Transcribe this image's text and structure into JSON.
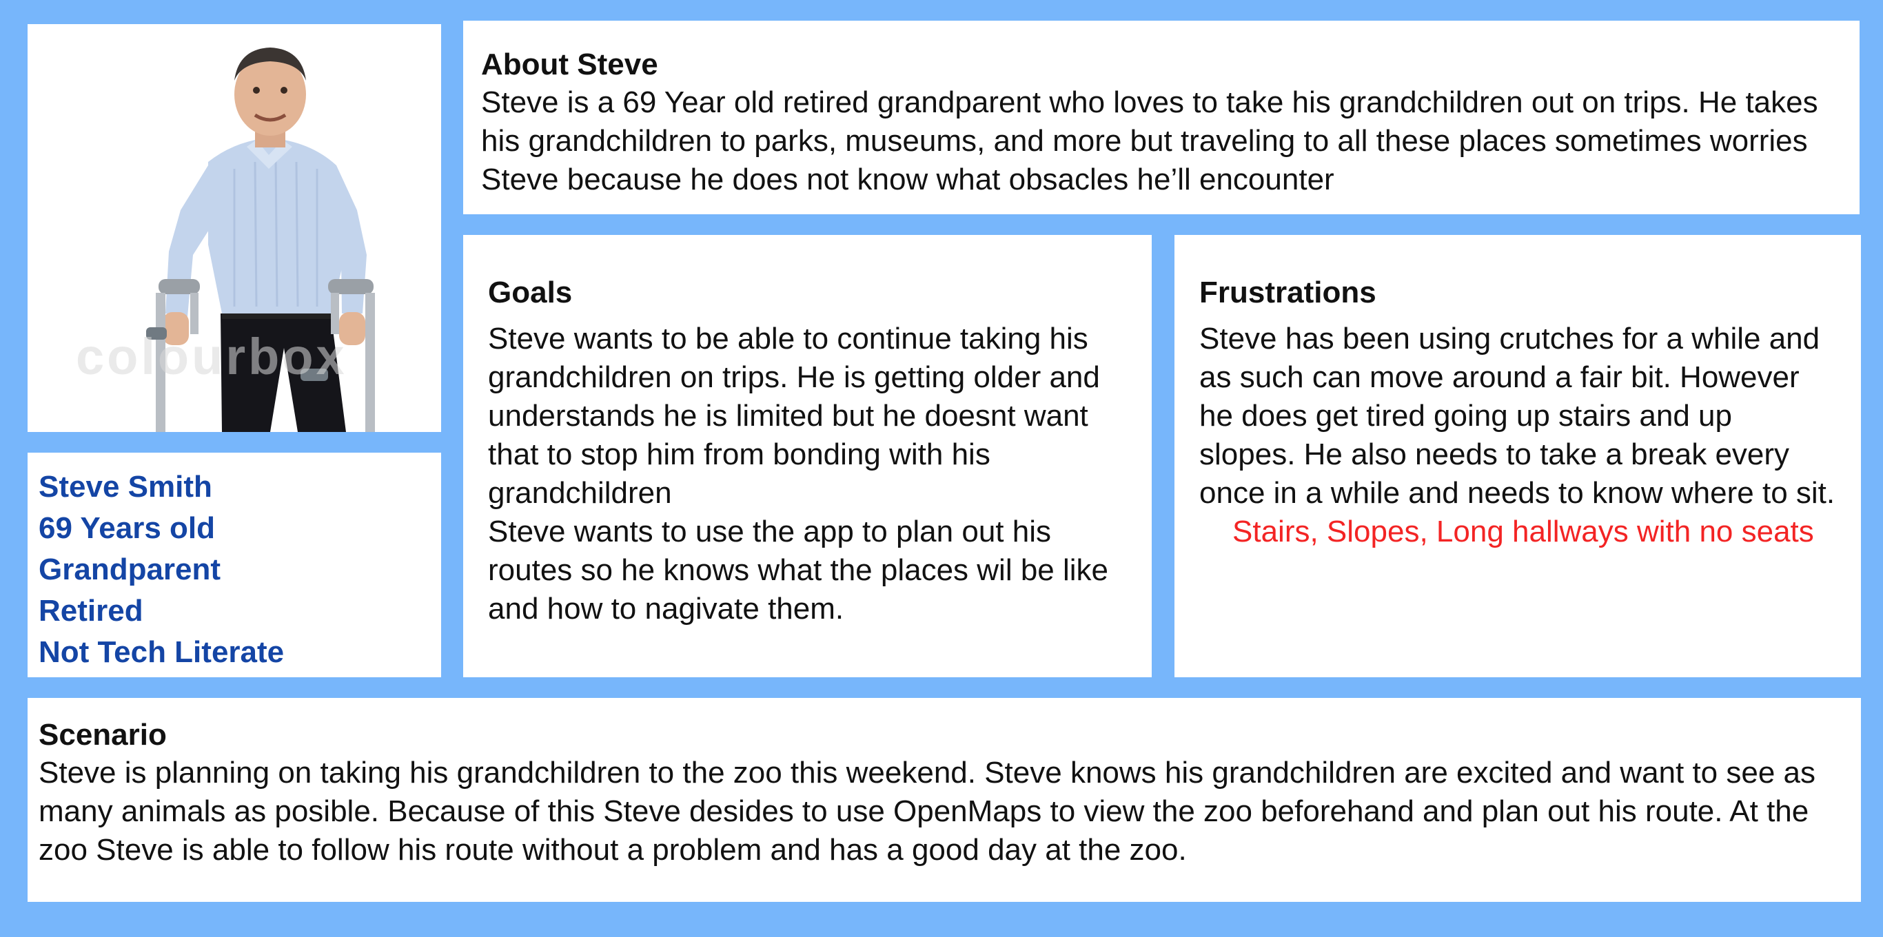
{
  "persona": {
    "name": "Steve Smith",
    "age": "69 Years old",
    "role": "Grandparent",
    "status": "Retired",
    "tech": "Not Tech Literate"
  },
  "photo": {
    "watermark": "colourbox"
  },
  "about": {
    "heading": "About Steve",
    "text": "Steve is a 69 Year old retired grandparent who loves to take his grandchildren out on trips. He takes his grandchildren to parks, museums, and more but traveling to all these places sometimes worries Steve because he does not know what obsacles he’ll encounter"
  },
  "goals": {
    "heading": "Goals",
    "paragraph1": "Steve wants to be able to continue taking his grandchildren on trips. He is getting older and understands he is limited but he doesnt want that to stop him from bonding with his grandchildren",
    "paragraph2": "Steve wants to use the app to plan out his routes so he knows what the places wil be like and how to nagivate them."
  },
  "frustrations": {
    "heading": "Frustrations",
    "text": "Steve has been using crutches for a while and as such can move around a fair bit. However he does get tired going up stairs and up slopes. He also needs to take a break every once in a while and needs to know where to sit.",
    "highlight": "Stairs, Slopes, Long hallways with no seats"
  },
  "scenario": {
    "heading": "Scenario",
    "text": "Steve is planning on taking his grandchildren to the zoo this weekend. Steve knows his grandchildren are excited and want to see as many animals as posible. Because of this Steve desides to use OpenMaps to view the zoo beforehand and plan out his route. At the zoo Steve is able to follow his route without a problem and has a good day at the zoo."
  },
  "colors": {
    "background": "#77b6fb",
    "panel": "#ffffff",
    "name_text": "#1445a5",
    "highlight_text": "#f32424"
  }
}
